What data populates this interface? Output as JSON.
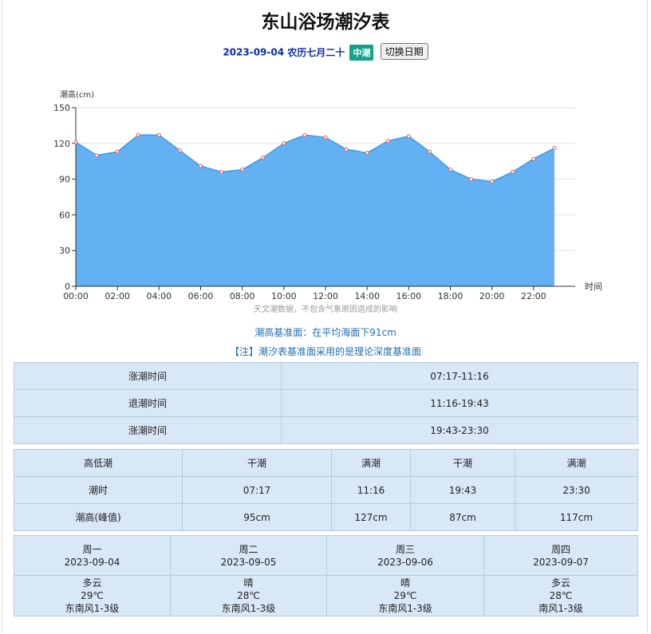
{
  "title": "东山浴场潮汐表",
  "date_line": {
    "date": "2023-09-04",
    "lunar": "农历七月二十",
    "tide_type": "中潮",
    "switch_button": "切换日期"
  },
  "chart_data": {
    "type": "area",
    "ylabel": "潮高(cm)",
    "xlabel": "时间",
    "ylim": [
      0,
      150
    ],
    "yticks": [
      "0",
      "30",
      "60",
      "90",
      "120",
      "150"
    ],
    "xticks": [
      "00:00",
      "02:00",
      "04:00",
      "06:00",
      "08:00",
      "10:00",
      "12:00",
      "14:00",
      "16:00",
      "18:00",
      "20:00",
      "22:00"
    ],
    "x": [
      "00:00",
      "01:00",
      "02:00",
      "03:00",
      "04:00",
      "05:00",
      "06:00",
      "07:00",
      "08:00",
      "09:00",
      "10:00",
      "11:00",
      "12:00",
      "13:00",
      "14:00",
      "15:00",
      "16:00",
      "17:00",
      "18:00",
      "19:00",
      "20:00",
      "21:00",
      "22:00",
      "23:00"
    ],
    "values": [
      121,
      110,
      113,
      127,
      127,
      114,
      101,
      96,
      98,
      108,
      120,
      127,
      125,
      115,
      112,
      122,
      126,
      113,
      98,
      90,
      88,
      96,
      107,
      116
    ],
    "caption": "天文潮数据，不包含气象原因造成的影响",
    "fill_color": "#63b1f2",
    "line_color": "#3a9ae8",
    "point_color": "#f05a5a",
    "grid": true
  },
  "datum_note": "潮高基准面：在平均海面下91cm",
  "depth_note": "【注】潮汐表基准面采用的是理论深度基准面",
  "tide_periods": [
    {
      "label": "涨潮时间",
      "value": "07:17-11:16"
    },
    {
      "label": "退潮时间",
      "value": "11:16-19:43"
    },
    {
      "label": "涨潮时间",
      "value": "19:43-23:30"
    }
  ],
  "tide_table": {
    "header": [
      "高低潮",
      "干潮",
      "满潮",
      "干潮",
      "满潮"
    ],
    "time_row": [
      "潮时",
      "07:17",
      "11:16",
      "19:43",
      "23:30"
    ],
    "height_row": [
      "潮高(峰值)",
      "95cm",
      "127cm",
      "87cm",
      "117cm"
    ]
  },
  "forecast": [
    {
      "weekday": "周一",
      "date": "2023-09-04",
      "weather": "多云",
      "temp": "29℃",
      "wind": "东南风1-3级"
    },
    {
      "weekday": "周二",
      "date": "2023-09-05",
      "weather": "晴",
      "temp": "28℃",
      "wind": "东南风1-3级"
    },
    {
      "weekday": "周三",
      "date": "2023-09-06",
      "weather": "晴",
      "temp": "29℃",
      "wind": "东南风1-3级"
    },
    {
      "weekday": "周四",
      "date": "2023-09-07",
      "weather": "多云",
      "temp": "28℃",
      "wind": "南风1-3级"
    }
  ]
}
